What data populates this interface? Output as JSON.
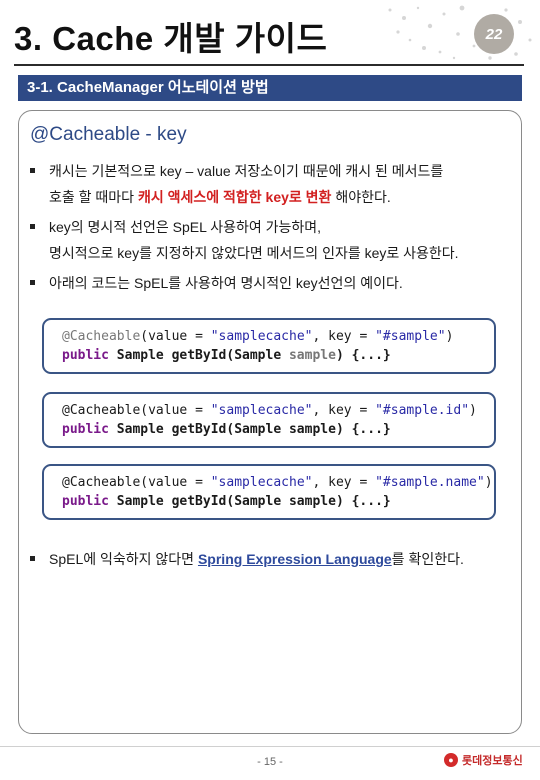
{
  "header": {
    "title": "3. Cache 개발 가이드",
    "badge": "22"
  },
  "section": {
    "title": "3-1. CacheManager 어노테이션 방법"
  },
  "panel": {
    "heading": "@Cacheable - key",
    "bullet1": {
      "line1": "캐시는 기본적으로 key – value 저장소이기 때문에 캐시 된 메서드를",
      "line2_pre": "호출 할 때마다 ",
      "line2_red": "캐시 액세스에 적합한 key로 변환",
      "line2_post": " 해야한다."
    },
    "bullet2": {
      "line1": "key의 명시적 선언은 SpEL 사용하여 가능하며,",
      "line2": "명시적으로 key를 지정하지 않았다면 메서드의 인자를 key로 사용한다."
    },
    "bullet3": "아래의 코드는 SpEL를 사용하여 명시적인 key선언의 예이다.",
    "code": [
      {
        "annotation": "@Cacheable",
        "open": "(value = ",
        "value": "\"samplecache\"",
        "mid": ", key = ",
        "key": "\"#sample\"",
        "close": ")",
        "kw": "public",
        "sig_pre": " Sample getById(Sample ",
        "param": "sample",
        "sig_post": ") {...}"
      },
      {
        "annotation": "@Cacheable",
        "open": "(value = ",
        "value": "\"samplecache\"",
        "mid": ", key = ",
        "key": "\"#sample.id\"",
        "close": ")",
        "kw": "public",
        "sig_pre": " Sample getById(Sample ",
        "param": "sample",
        "sig_post": ") {...}"
      },
      {
        "annotation": "@Cacheable",
        "open": "(value = ",
        "value": "\"samplecache\"",
        "mid": ", key = ",
        "key": "\"#sample.name\"",
        "close": ")",
        "kw": "public",
        "sig_pre": " Sample getById(Sample ",
        "param": "sample",
        "sig_post": ") {...}"
      }
    ],
    "bullet4": {
      "pre": "SpEL에 익숙하지 않다면 ",
      "link": "Spring Expression Language",
      "post": "를 확인한다."
    }
  },
  "footer": {
    "page": "- 15 -",
    "logo": "롯데정보통신"
  },
  "colors": {
    "accent": "#2e4a86",
    "highlight": "#d22020"
  }
}
